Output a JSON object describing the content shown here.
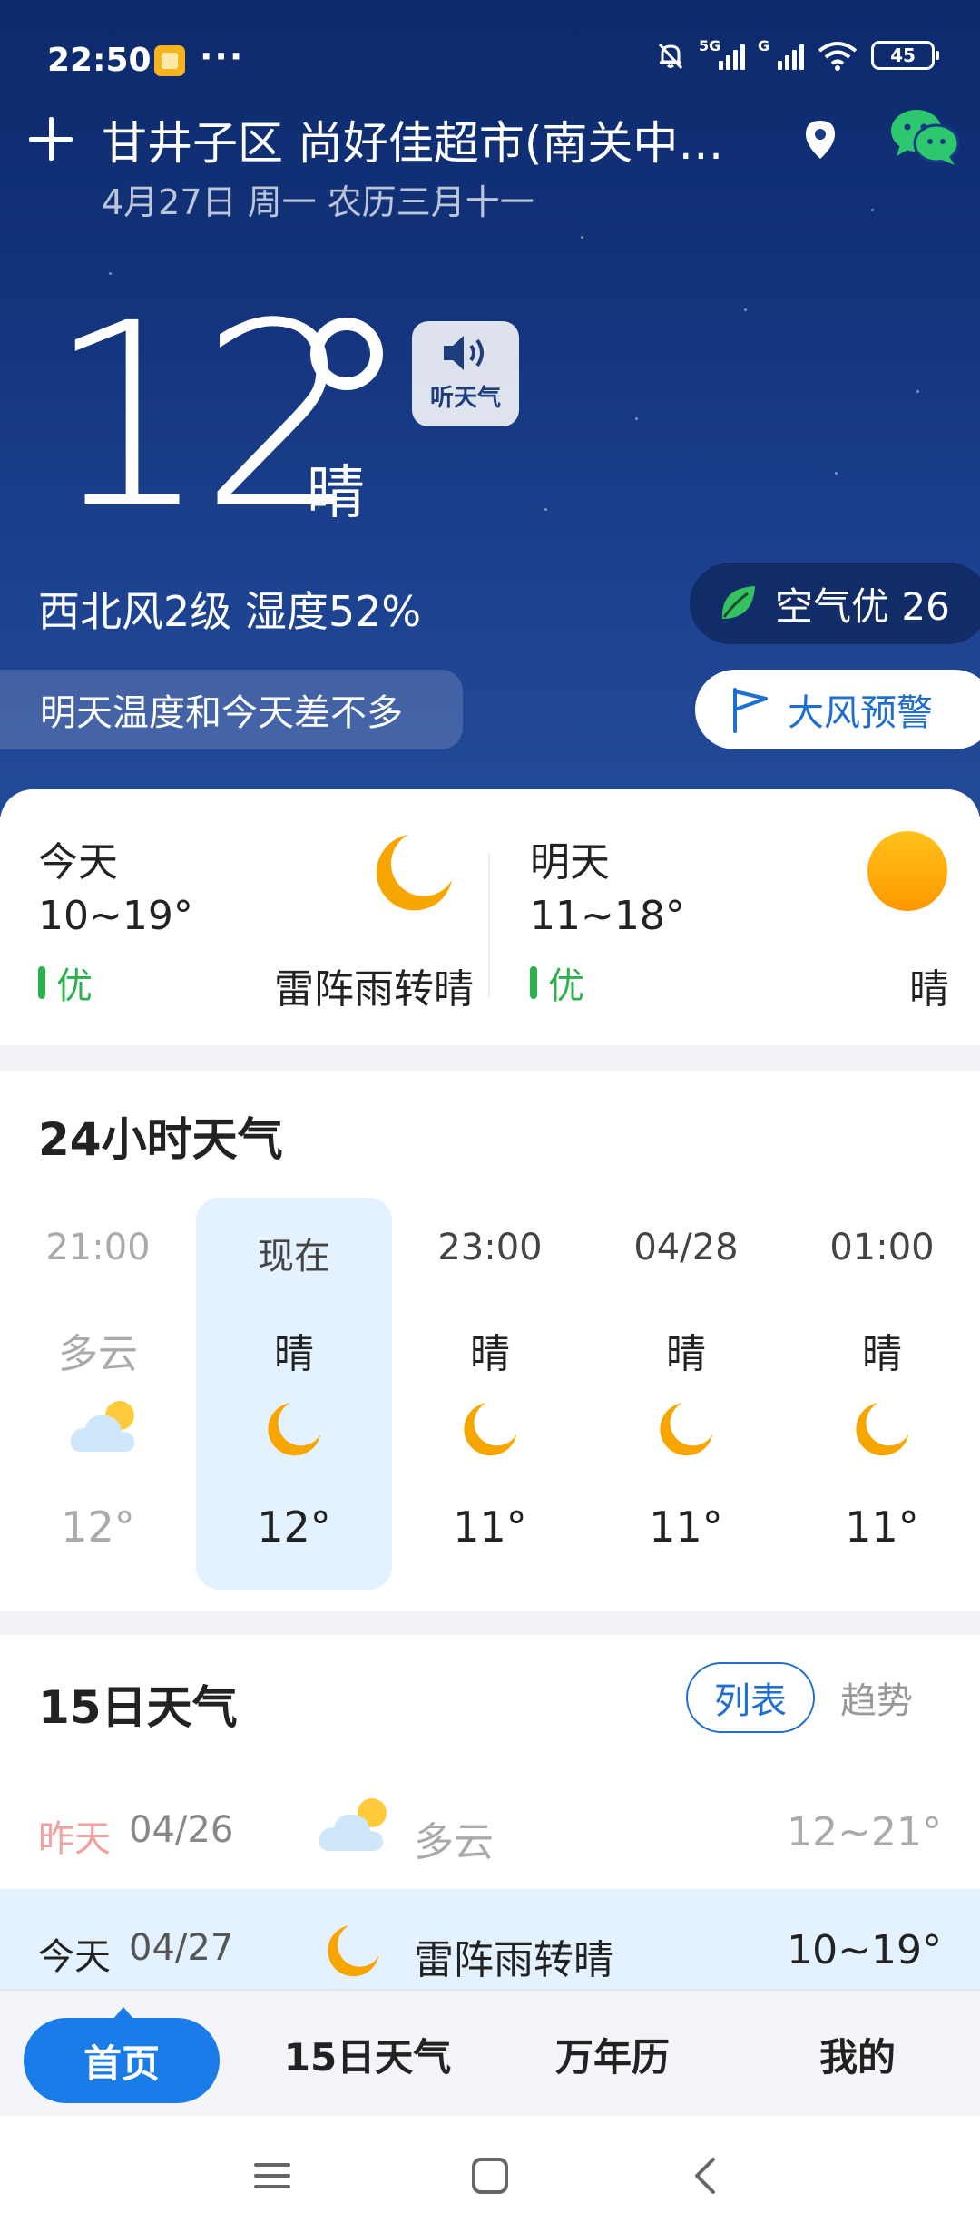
{
  "status_bar": {
    "time": "22:50",
    "dots": "···",
    "sig1": "5G",
    "sig2": "G",
    "battery": "45"
  },
  "header": {
    "location": "甘井子区 尚好佳超市(南关中…",
    "date": "4月27日 周一 农历三月十一"
  },
  "current": {
    "temperature": "12",
    "condition": "晴",
    "listen_label": "听天气",
    "wind_humidity": "西北风2级 湿度52%",
    "air_quality": "空气优 26",
    "hint": "明天温度和今天差不多",
    "alert": "大风预警"
  },
  "daily_summary": [
    {
      "label": "今天",
      "range": "10~19°",
      "aqi": "优",
      "condition": "雷阵雨转晴",
      "icon": "moon-icon"
    },
    {
      "label": "明天",
      "range": "11~18°",
      "aqi": "优",
      "condition": "晴",
      "icon": "sun-icon"
    }
  ],
  "hourly": {
    "title": "24小时天气",
    "items": [
      {
        "time": "21:00",
        "condition": "多云",
        "icon": "cloudy-icon",
        "temp": "12°",
        "state": "past"
      },
      {
        "time": "现在",
        "condition": "晴",
        "icon": "moon-icon",
        "temp": "12°",
        "state": "now"
      },
      {
        "time": "23:00",
        "condition": "晴",
        "icon": "moon-icon",
        "temp": "11°",
        "state": "future"
      },
      {
        "time": "04/28",
        "condition": "晴",
        "icon": "moon-icon",
        "temp": "11°",
        "state": "future"
      },
      {
        "time": "01:00",
        "condition": "晴",
        "icon": "moon-icon",
        "temp": "11°",
        "state": "future"
      }
    ]
  },
  "forecast15": {
    "title": "15日天气",
    "view_list": "列表",
    "view_trend": "趋势",
    "rows": [
      {
        "day": "昨天",
        "date": "04/26",
        "condition": "多云",
        "range": "12~21°",
        "icon": "cloudy-icon",
        "state": "past"
      },
      {
        "day": "今天",
        "date": "04/27",
        "condition": "雷阵雨转晴",
        "range": "10~19°",
        "icon": "moon-icon",
        "state": "current"
      }
    ]
  },
  "tabs": [
    "首页",
    "15日天气",
    "万年历",
    "我的"
  ],
  "colors": {
    "accent": "#1a7ce8",
    "good_aqi": "#2bb24c",
    "moon": "#f7a600",
    "hero_top": "#0c2a6c"
  }
}
